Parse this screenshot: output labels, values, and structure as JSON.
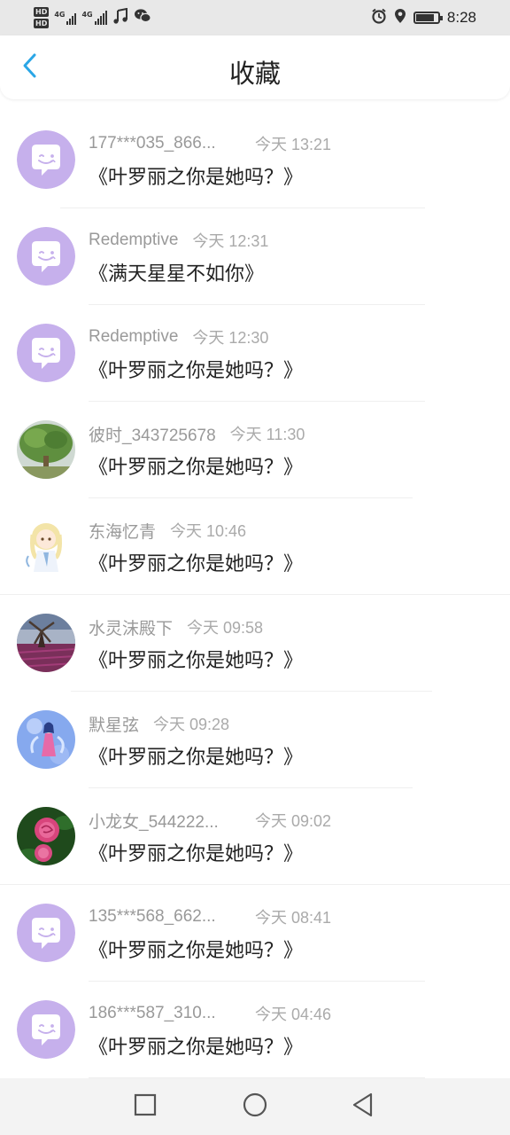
{
  "status_bar": {
    "hd_badges": [
      "HD",
      "HD"
    ],
    "network_labels": [
      "4G",
      "4G"
    ],
    "icons": [
      "music-icon",
      "wechat-icon",
      "alarm-icon",
      "location-icon"
    ],
    "battery_level": 0.85,
    "time": "8:28"
  },
  "header": {
    "back_icon": "chevron-left-icon",
    "title": "收藏",
    "accent_color": "#2aa6e6"
  },
  "items": [
    {
      "name": "177***035_866...",
      "time": "今天 13:21",
      "message": "《叶罗丽之你是她吗？》",
      "avatar": "default-chat-avatar"
    },
    {
      "name": "Redemptive",
      "time": "今天 12:31",
      "message": "《满天星星不如你》",
      "avatar": "default-chat-avatar"
    },
    {
      "name": "Redemptive",
      "time": "今天 12:30",
      "message": "《叶罗丽之你是她吗？》",
      "avatar": "default-chat-avatar"
    },
    {
      "name": "彼时_343725678",
      "time": "今天 11:30",
      "message": "《叶罗丽之你是她吗？》",
      "avatar": "tree-photo-avatar"
    },
    {
      "name": "东海忆青",
      "time": "今天 10:46",
      "message": "《叶罗丽之你是她吗？》",
      "avatar": "anime-girl-avatar"
    },
    {
      "name": "水灵沫殿下",
      "time": "今天 09:58",
      "message": "《叶罗丽之你是她吗？》",
      "avatar": "windmill-field-avatar"
    },
    {
      "name": "默星弦",
      "time": "今天 09:28",
      "message": "《叶罗丽之你是她吗？》",
      "avatar": "fairy-blue-avatar"
    },
    {
      "name": "小龙女_544222...",
      "time": "今天 09:02",
      "message": "《叶罗丽之你是她吗？》",
      "avatar": "pink-rose-avatar"
    },
    {
      "name": "135***568_662...",
      "time": "今天 08:41",
      "message": "《叶罗丽之你是她吗？》",
      "avatar": "default-chat-avatar"
    },
    {
      "name": "186***587_310...",
      "time": "今天 04:46",
      "message": "《叶罗丽之你是她吗？》",
      "avatar": "default-chat-avatar"
    }
  ],
  "nav_bar": {
    "buttons": [
      "recent-apps-icon",
      "home-icon",
      "back-triangle-icon"
    ]
  },
  "colors": {
    "default_avatar_bg": "#c6b0ec",
    "name_text": "#999999",
    "message_text": "#222222"
  }
}
